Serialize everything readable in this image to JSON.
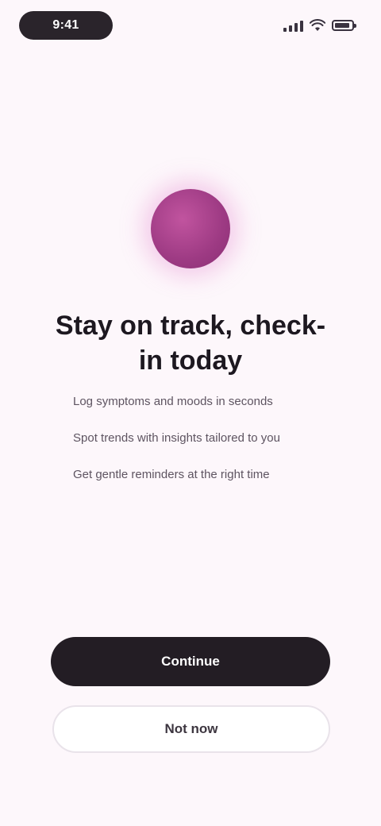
{
  "status_bar": {
    "time": "9:41",
    "icons": [
      "signal-icon",
      "wifi-icon",
      "battery-icon"
    ]
  },
  "hero": {
    "icon": "orb-icon",
    "accent_color": "#a3418a"
  },
  "title": "Stay on track, check-in today",
  "features": [
    "Log symptoms and moods in seconds",
    "Spot trends with insights tailored to you",
    "Get gentle reminders at the right time"
  ],
  "actions": {
    "primary_label": "Continue",
    "secondary_label": "Not now"
  },
  "colors": {
    "background": "#fdf7fb",
    "primary_button": "#231d24",
    "text": "#1d1820"
  }
}
